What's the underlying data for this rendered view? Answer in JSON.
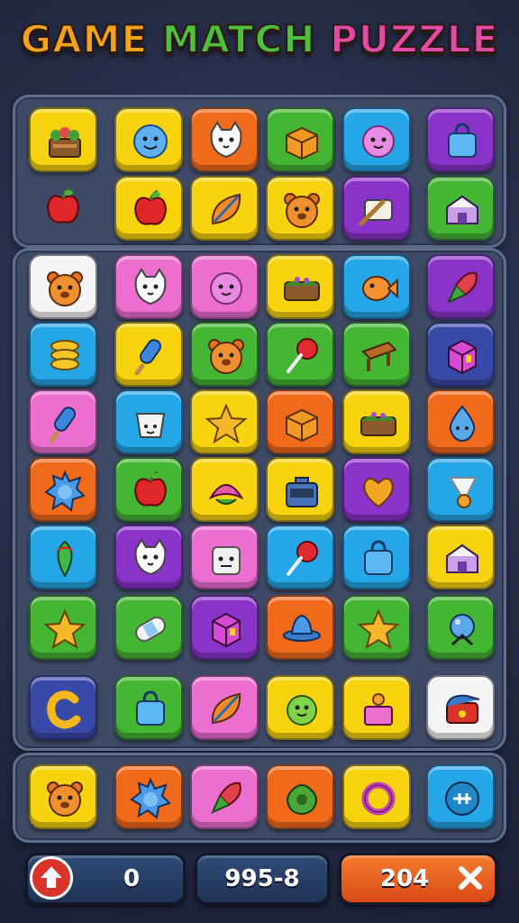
{
  "title": {
    "words": [
      {
        "text": "GAME",
        "color": "#f7a21b"
      },
      {
        "text": "MATCH",
        "color": "#4fc03c"
      },
      {
        "text": "PUZZLE",
        "color": "#e64aa8"
      }
    ]
  },
  "colors": {
    "yellow": "#f6d20f",
    "orange": "#f06a1c",
    "green": "#45b534",
    "blue": "#25a6e6",
    "purple": "#8a33c9",
    "pink": "#ec6fd0",
    "white": "#f4f4f4",
    "navy": "#3949a8"
  },
  "top_grid": [
    [
      {
        "color": "yellow",
        "icon": "basket-icon"
      },
      {
        "color": "yellow",
        "icon": "blue-face-icon"
      },
      {
        "color": "orange",
        "icon": "cat-face-icon"
      },
      {
        "color": "green",
        "icon": "box-icon"
      },
      {
        "color": "blue",
        "icon": "pink-face-icon"
      },
      {
        "color": "purple",
        "icon": "bag-icon"
      }
    ],
    [
      {
        "color": "none",
        "icon": "apple-icon"
      },
      {
        "color": "yellow",
        "icon": "apple-icon"
      },
      {
        "color": "yellow",
        "icon": "leaf-icon"
      },
      {
        "color": "yellow",
        "icon": "bear-face-icon"
      },
      {
        "color": "purple",
        "icon": "scroll-icon"
      },
      {
        "color": "green",
        "icon": "house-icon"
      }
    ]
  ],
  "main_grid": [
    [
      {
        "color": "white",
        "icon": "bear-face-icon"
      },
      {
        "color": "pink",
        "icon": "cat-face-icon"
      },
      {
        "color": "pink",
        "icon": "pink-face-icon"
      },
      {
        "color": "yellow",
        "icon": "cake-icon"
      },
      {
        "color": "blue",
        "icon": "fish-icon"
      },
      {
        "color": "purple",
        "icon": "rocket-icon"
      }
    ],
    [
      {
        "color": "blue",
        "icon": "coins-icon"
      },
      {
        "color": "yellow",
        "icon": "popsicle-icon"
      },
      {
        "color": "green",
        "icon": "bear-face-icon"
      },
      {
        "color": "green",
        "icon": "lollipop-icon"
      },
      {
        "color": "green",
        "icon": "bench-icon"
      },
      {
        "color": "navy",
        "icon": "cube-icon"
      }
    ],
    [
      {
        "color": "pink",
        "icon": "popsicle-icon"
      },
      {
        "color": "blue",
        "icon": "cup-icon"
      },
      {
        "color": "yellow",
        "icon": "star-icon"
      },
      {
        "color": "orange",
        "icon": "box-icon"
      },
      {
        "color": "yellow",
        "icon": "cake-icon"
      },
      {
        "color": "orange",
        "icon": "drop-face-icon"
      }
    ],
    [
      {
        "color": "orange",
        "icon": "spiky-icon"
      },
      {
        "color": "green",
        "icon": "apple-icon"
      },
      {
        "color": "yellow",
        "icon": "flower-icon"
      },
      {
        "color": "yellow",
        "icon": "chest-icon"
      },
      {
        "color": "purple",
        "icon": "heart-icon"
      },
      {
        "color": "blue",
        "icon": "shuttlecock-icon"
      }
    ],
    [
      {
        "color": "blue",
        "icon": "bobber-icon"
      },
      {
        "color": "purple",
        "icon": "cat-face-icon"
      },
      {
        "color": "pink",
        "icon": "cube-face-icon"
      },
      {
        "color": "blue",
        "icon": "lollipop-icon"
      },
      {
        "color": "blue",
        "icon": "bag-icon"
      },
      {
        "color": "yellow",
        "icon": "house-icon"
      }
    ],
    [
      {
        "color": "green",
        "icon": "star-icon"
      },
      {
        "color": "green",
        "icon": "bandage-icon"
      },
      {
        "color": "purple",
        "icon": "cube-icon"
      },
      {
        "color": "orange",
        "icon": "hat-icon"
      },
      {
        "color": "green",
        "icon": "star-icon"
      },
      {
        "color": "green",
        "icon": "orb-icon"
      }
    ],
    [
      {
        "color": "navy",
        "icon": "letter-c-icon"
      },
      {
        "color": "green",
        "icon": "bag-icon"
      },
      {
        "color": "pink",
        "icon": "leaf-icon"
      },
      {
        "color": "yellow",
        "icon": "green-face-icon"
      },
      {
        "color": "yellow",
        "icon": "gift-icon"
      },
      {
        "color": "white",
        "icon": "mailbox-icon"
      }
    ]
  ],
  "tray": [
    {
      "color": "yellow",
      "icon": "bear-face-icon"
    },
    {
      "color": "orange",
      "icon": "spiky-icon"
    },
    {
      "color": "pink",
      "icon": "rocket-icon"
    },
    {
      "color": "orange",
      "icon": "blob-icon"
    },
    {
      "color": "yellow",
      "icon": "ring-icon"
    },
    {
      "color": "blue",
      "icon": "plus-icon"
    }
  ],
  "bottom": {
    "left_value": "0",
    "center_value": "995-8",
    "right_value": "204"
  }
}
